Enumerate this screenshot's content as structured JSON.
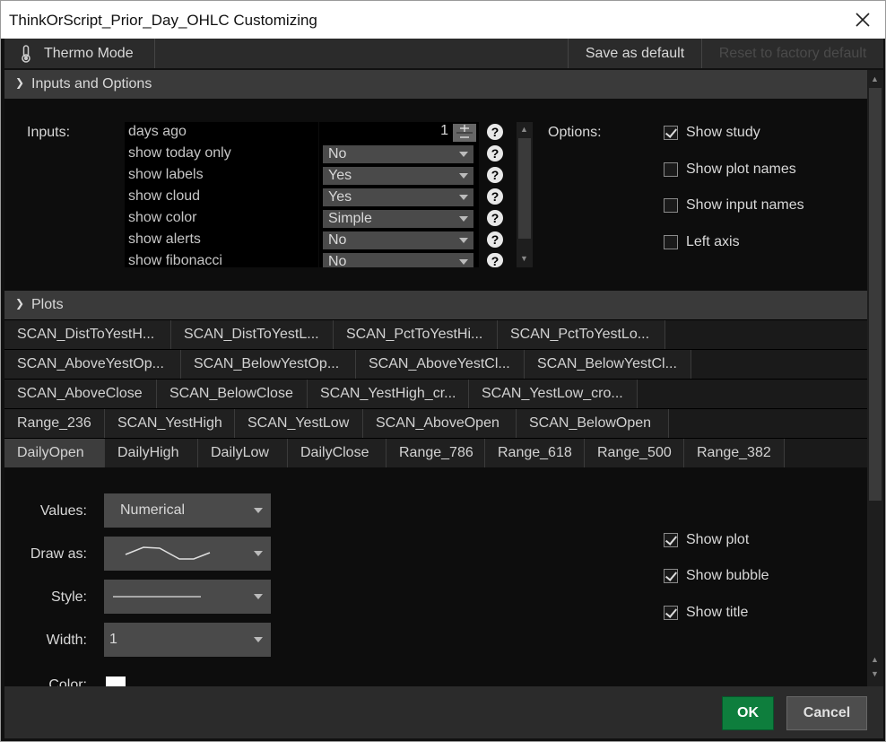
{
  "window": {
    "title": "ThinkOrScript_Prior_Day_OHLC Customizing",
    "close_icon": "close-icon"
  },
  "toolbar": {
    "thermo_mode": "Thermo Mode",
    "save_as_default": "Save as default",
    "reset_to_factory_default": "Reset to factory default"
  },
  "inputs_section": {
    "title": "Inputs and Options",
    "inputs_label": "Inputs:",
    "options_label": "Options:",
    "inputs": [
      {
        "name": "days ago",
        "value": "1",
        "type": "spinner"
      },
      {
        "name": "show today only",
        "value": "No",
        "type": "dropdown"
      },
      {
        "name": "show labels",
        "value": "Yes",
        "type": "dropdown"
      },
      {
        "name": "show cloud",
        "value": "Yes",
        "type": "dropdown"
      },
      {
        "name": "show color",
        "value": "Simple",
        "type": "dropdown"
      },
      {
        "name": "show alerts",
        "value": "No",
        "type": "dropdown"
      },
      {
        "name": "show fibonacci",
        "value": "No",
        "type": "dropdown"
      }
    ],
    "help_glyph": "?",
    "options": [
      {
        "label": "Show study",
        "checked": true
      },
      {
        "label": "Show plot names",
        "checked": false
      },
      {
        "label": "Show input names",
        "checked": false
      },
      {
        "label": "Left axis",
        "checked": false
      }
    ]
  },
  "plots_section": {
    "title": "Plots",
    "tab_rows": [
      [
        "SCAN_DistToYestH...",
        "SCAN_DistToYestL...",
        "SCAN_PctToYestHi...",
        "SCAN_PctToYestLo..."
      ],
      [
        "SCAN_AboveYestOp...",
        "SCAN_BelowYestOp...",
        "SCAN_AboveYestCl...",
        "SCAN_BelowYestCl..."
      ],
      [
        "SCAN_AboveClose",
        "SCAN_BelowClose",
        "SCAN_YestHigh_cr...",
        "SCAN_YestLow_cro..."
      ],
      [
        "Range_236",
        "SCAN_YestHigh",
        "SCAN_YestLow",
        "SCAN_AboveOpen",
        "SCAN_BelowOpen"
      ],
      [
        "DailyOpen",
        "DailyHigh",
        "DailyLow",
        "DailyClose",
        "Range_786",
        "Range_618",
        "Range_500",
        "Range_382"
      ]
    ],
    "selected_tab": "DailyOpen",
    "values_label": "Values:",
    "values_value": "Numerical",
    "draw_as_label": "Draw as:",
    "style_label": "Style:",
    "width_label": "Width:",
    "width_value": "1",
    "color_label": "Color:",
    "color_value": "#ffffff",
    "plot_options": [
      {
        "label": "Show plot",
        "checked": true
      },
      {
        "label": "Show bubble",
        "checked": true
      },
      {
        "label": "Show title",
        "checked": true
      }
    ]
  },
  "footer": {
    "ok": "OK",
    "cancel": "Cancel"
  }
}
